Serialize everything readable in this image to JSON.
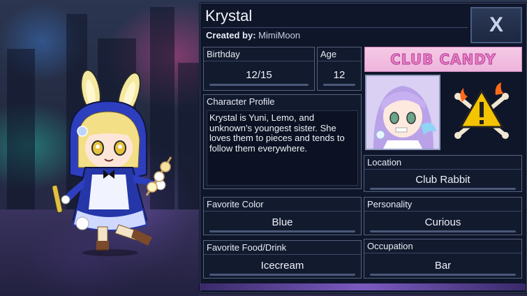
{
  "header": {
    "name": "Krystal",
    "created_by_label": "Created by:",
    "created_by_value": "MimiMoon",
    "close_label": "X"
  },
  "fields": {
    "birthday": {
      "label": "Birthday",
      "value": "12/15"
    },
    "age": {
      "label": "Age",
      "value": "12"
    },
    "profile": {
      "label": "Character Profile",
      "value": "Krystal is Yuni, Lemo, and unknown's youngest sister. She loves them to pieces and tends to follow them everywhere."
    },
    "location": {
      "label": "Location",
      "value": "Club Rabbit"
    },
    "favorite_color": {
      "label": "Favorite Color",
      "value": "Blue"
    },
    "personality": {
      "label": "Personality",
      "value": "Curious"
    },
    "favorite_food": {
      "label": "Favorite Food/Drink",
      "value": "Icecream"
    },
    "occupation": {
      "label": "Occupation",
      "value": "Bar"
    }
  },
  "banner": {
    "text": "CLUB CANDY"
  },
  "icons": [
    "close-icon",
    "warning-icon",
    "portrait-image",
    "character-figure"
  ],
  "colors": {
    "panel": "#0f1629",
    "border": "#56627f",
    "banner_pink": "#f07cc6",
    "warning_yellow": "#f5c400"
  }
}
